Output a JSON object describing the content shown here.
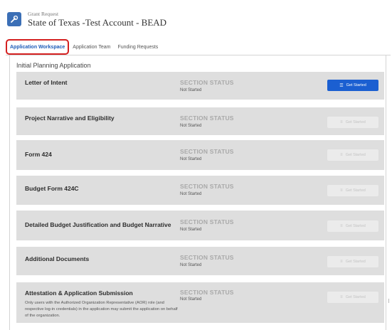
{
  "header": {
    "subtitle": "Grant Request",
    "title": "State of Texas -Test Account - BEAD",
    "icon": "wrench-icon"
  },
  "tabs": [
    {
      "label": "Application Workspace",
      "active": true
    },
    {
      "label": "Application Team",
      "active": false
    },
    {
      "label": "Funding Requests",
      "active": false
    }
  ],
  "panel": {
    "title": "Initial Planning Application"
  },
  "status_heading": "SECTION STATUS",
  "sections": [
    {
      "name": "Letter of Intent",
      "status": "Not Started",
      "button": "Get Started",
      "enabled": true
    },
    {
      "name": "Project Narrative and Eligibility",
      "status": "Not Started",
      "button": "Get Started",
      "enabled": false
    },
    {
      "name": "Form 424",
      "status": "Not Started",
      "button": "Get Started",
      "enabled": false
    },
    {
      "name": "Budget Form 424C",
      "status": "Not Started",
      "button": "Get Started",
      "enabled": false
    },
    {
      "name": "Detailed Budget Justification and Budget Narrative",
      "status": "Not Started",
      "button": "Get Started",
      "enabled": false
    },
    {
      "name": "Additional Documents",
      "status": "Not Started",
      "button": "Get Started",
      "enabled": false
    },
    {
      "name": "Attestation & Application Submission",
      "description": "Only users with the Authorized Organization Representative (AOR) role (and respective log-in credentials) in the application may submit the application on behalf of the organization.",
      "status": "Not Started",
      "button": "Get Started",
      "enabled": false
    }
  ],
  "colors": {
    "primary": "#1b5fd1",
    "active_tab": "#1c5bb8",
    "highlight": "#d42020",
    "section_bg": "#dedede"
  }
}
